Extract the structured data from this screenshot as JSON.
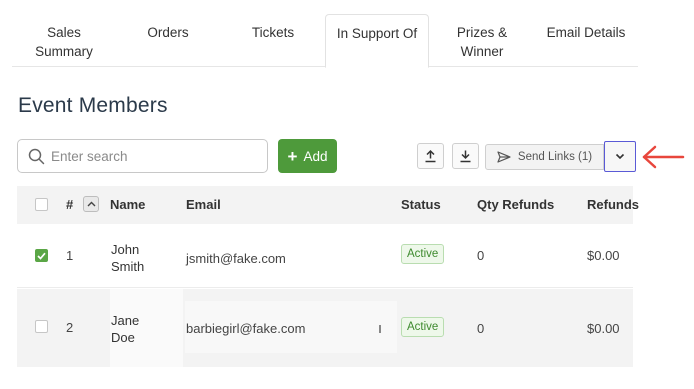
{
  "tabs": [
    {
      "line1": "Sales",
      "line2": "Summary"
    },
    {
      "line1": "Orders",
      "line2": ""
    },
    {
      "line1": "Tickets",
      "line2": ""
    },
    {
      "line1": "In Support Of",
      "line2": ""
    },
    {
      "line1": "Prizes &",
      "line2": "Winner"
    },
    {
      "line1": "Email Details",
      "line2": ""
    }
  ],
  "active_tab": "In Support Of",
  "page_title": "Event Members",
  "search": {
    "placeholder": "Enter search",
    "value": ""
  },
  "toolbar": {
    "add_label": "Add",
    "add_icon": "plus-icon",
    "upload_icon": "upload-icon",
    "download_icon": "download-icon",
    "send_links_label": "Send Links (1)",
    "send_icon": "paper-plane-icon",
    "dropdown_icon": "chevron-down-icon"
  },
  "table": {
    "columns": [
      "#",
      "Name",
      "Email",
      "Status",
      "Qty Refunds",
      "Refunds"
    ],
    "rows": [
      {
        "checked": true,
        "num": "1",
        "name_first": "John",
        "name_last": "Smith",
        "email": "jsmith@fake.com",
        "status": "Active",
        "qty_refunds": "0",
        "refunds": "$0.00"
      },
      {
        "checked": false,
        "num": "2",
        "name_first": "Jane",
        "name_last": "Doe",
        "email": "barbiegirl@fake.com",
        "status": "Active",
        "qty_refunds": "0",
        "refunds": "$0.00"
      }
    ]
  },
  "colors": {
    "accent_green": "#4e9a3b",
    "highlight_border": "#5a5ad6",
    "annotation_arrow": "#e8463c"
  }
}
